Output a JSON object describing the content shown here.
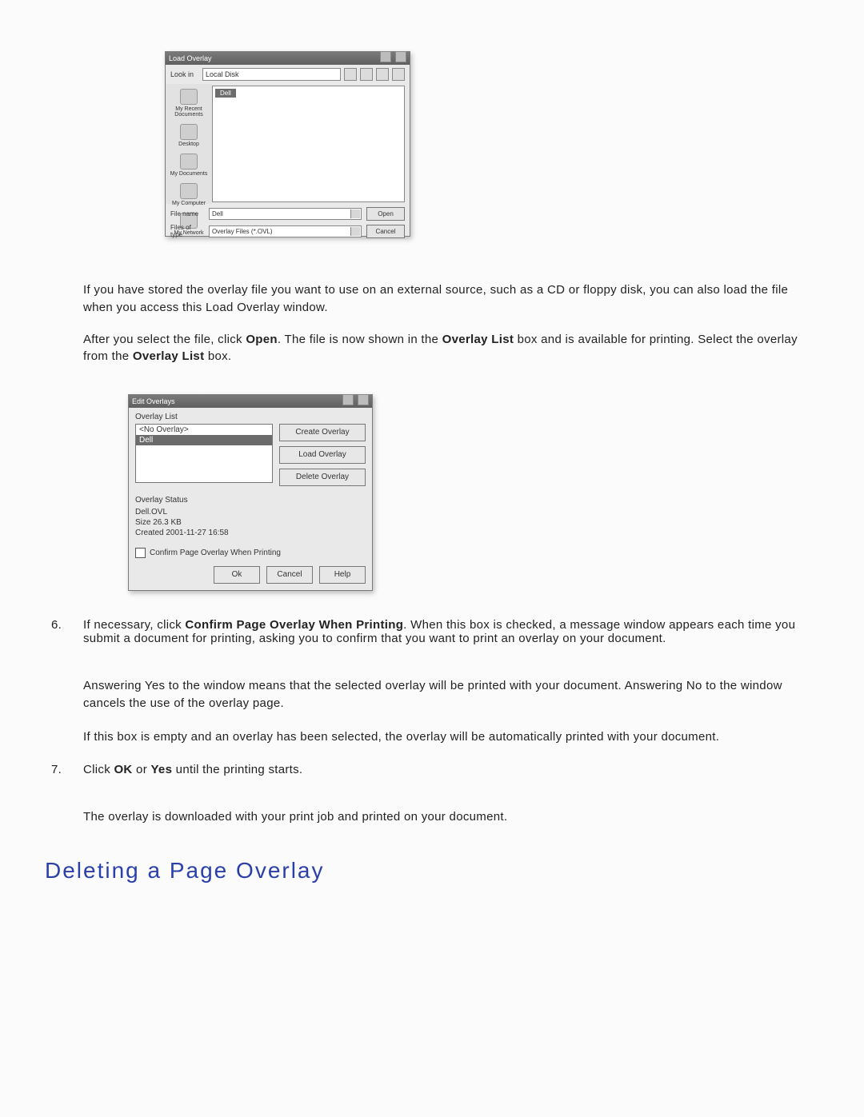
{
  "load_overlay_dialog": {
    "title": "Load Overlay",
    "lookin_label": "Look in",
    "lookin_value": "Local Disk",
    "sidebar": [
      {
        "label": "My Recent\nDocuments"
      },
      {
        "label": "Desktop"
      },
      {
        "label": "My Documents"
      },
      {
        "label": "My Computer"
      },
      {
        "label": "My Network"
      }
    ],
    "file_item": "Dell",
    "filename_label": "File name",
    "filename_value": "Dell",
    "filetype_label": "Files of type",
    "filetype_value": "Overlay Files (*.OVL)",
    "open_btn": "Open",
    "cancel_btn": "Cancel"
  },
  "para1": "If you have stored the overlay file you want to use on an external source, such as a CD or floppy disk, you can also load the file when you access this Load Overlay window.",
  "para2_a": "After you select the file, click ",
  "para2_b_bold": "Open",
  "para2_c": ". The file is now shown in the ",
  "para2_d_bold": "Overlay List",
  "para2_e": " box and is available for printing. Select the overlay from the ",
  "para2_f_bold": "Overlay List",
  "para2_g": " box.",
  "edit_overlays_dialog": {
    "title": "Edit Overlays",
    "list_label": "Overlay List",
    "list_items": [
      "<No Overlay>",
      "Dell"
    ],
    "selected_index": 1,
    "btn_create": "Create Overlay",
    "btn_load": "Load Overlay",
    "btn_delete": "Delete Overlay",
    "status_label": "Overlay Status",
    "status_lines": [
      "Dell.OVL",
      "Size 26.3 KB",
      "Created 2001-11-27 16:58"
    ],
    "checkbox_label": "Confirm Page Overlay When Printing",
    "ok": "Ok",
    "cancel": "Cancel",
    "help": "Help"
  },
  "step6_a": "If necessary, click ",
  "step6_b_bold": "Confirm Page Overlay When Printing",
  "step6_c": ". When this box is checked, a message window appears each time you submit a document for printing, asking you to confirm that you want to print an overlay on your document.",
  "step6_sub1": "Answering Yes to the window means that the selected overlay will be printed with your document. Answering No to the window cancels the use of the overlay page.",
  "step6_sub2": "If this box is empty and an overlay has been selected, the overlay will be automatically printed with your document.",
  "step7_a": "Click ",
  "step7_b_bold": "OK",
  "step7_c": " or ",
  "step7_d_bold": "Yes",
  "step7_e": " until the printing starts.",
  "step7_sub": "The overlay is downloaded with your print job and printed on your document.",
  "heading": "Deleting a Page Overlay"
}
